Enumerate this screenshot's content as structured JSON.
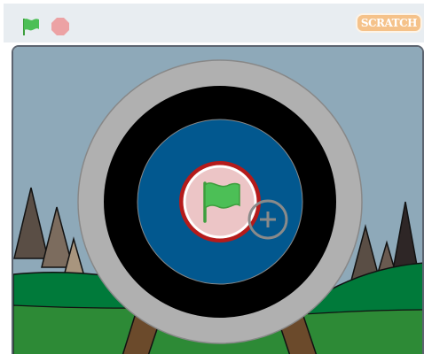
{
  "toolbar": {
    "green_flag": "green-flag-icon",
    "stop": "stop-icon",
    "logo_text": "SCRATCH"
  },
  "stage": {
    "overlay": "green-flag-overlay",
    "cursor": "crosshair-plus"
  },
  "colors": {
    "sky": "#8ea9b9",
    "grass": "#2d8a36",
    "blue": "#02588f",
    "red": "#b51b1b",
    "gray": "#b0b0b0"
  }
}
